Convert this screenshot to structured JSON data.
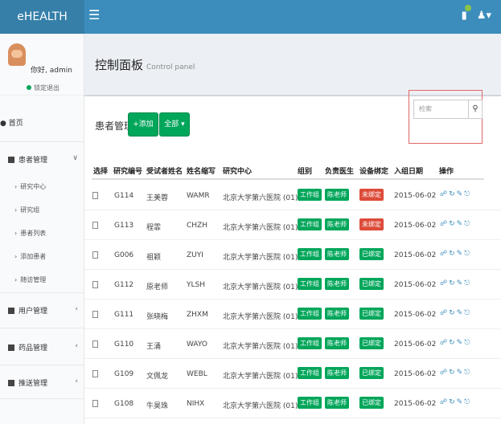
{
  "app": {
    "logo": "eHEALTH",
    "menu_icon": "hamburger-icon",
    "notif_icon": "battery-icon",
    "user_icon": "user-icon"
  },
  "user": {
    "greeting": "你好, admin",
    "status": "锁定退出"
  },
  "sidebar": {
    "home": "首页",
    "patient_mgmt": "患者管理",
    "sub": [
      "研究中心",
      "研究组",
      "患者列表",
      "添加患者",
      "随访管理"
    ],
    "user_mgmt": "用户管理",
    "drug_mgmt": "药品管理",
    "followup_mgmt": "推送管理"
  },
  "page": {
    "title": "控制面板",
    "subtitle": "Control panel"
  },
  "box": {
    "title": "患者管理",
    "add_label": "+添加",
    "all_label": "全部 ▾"
  },
  "search": {
    "placeholder": "检索"
  },
  "table": {
    "headers": [
      "选择",
      "研究编号",
      "受试者姓名",
      "姓名缩写",
      "研究中心",
      "组别",
      "负责医生",
      "设备绑定",
      "入组日期",
      "操作"
    ],
    "rows": [
      {
        "id": "G114",
        "name": "王美蓉",
        "abbr": "WAMR",
        "center": "北京大学第六医院 (01)",
        "group": "工作组",
        "doctor": "陈老师",
        "device": "未绑定",
        "date": "2015-06-02"
      },
      {
        "id": "G113",
        "name": "程霏",
        "abbr": "CHZH",
        "center": "北京大学第六医院 (01)",
        "group": "工作组",
        "doctor": "陈老师",
        "device": "未绑定",
        "date": "2015-06-02"
      },
      {
        "id": "G006",
        "name": "祖颖",
        "abbr": "ZUYI",
        "center": "北京大学第六医院 (01)",
        "group": "工作组",
        "doctor": "陈老师",
        "device": "已绑定",
        "date": "2015-06-02"
      },
      {
        "id": "G112",
        "name": "原老师",
        "abbr": "YLSH",
        "center": "北京大学第六医院 (01)",
        "group": "工作组",
        "doctor": "陈老师",
        "device": "已绑定",
        "date": "2015-06-02"
      },
      {
        "id": "G111",
        "name": "张晓梅",
        "abbr": "ZHXM",
        "center": "北京大学第六医院 (01)",
        "group": "工作组",
        "doctor": "陈老师",
        "device": "已绑定",
        "date": "2015-06-02"
      },
      {
        "id": "G110",
        "name": "王涌",
        "abbr": "WAYO",
        "center": "北京大学第六医院 (01)",
        "group": "工作组",
        "doctor": "陈老师",
        "device": "已绑定",
        "date": "2015-06-02"
      },
      {
        "id": "G109",
        "name": "文佩龙",
        "abbr": "WEBL",
        "center": "北京大学第六医院 (01)",
        "group": "工作组",
        "doctor": "陈老师",
        "device": "已绑定",
        "date": "2015-06-02"
      },
      {
        "id": "G108",
        "name": "牛昊珠",
        "abbr": "NIHX",
        "center": "北京大学第六医院 (01)",
        "group": "工作组",
        "doctor": "陈老师",
        "device": "已绑定",
        "date": "2015-06-02"
      }
    ],
    "ops": "⊖⟳☑🗑"
  },
  "colors": {
    "accent": "#3c8dbc",
    "green": "#00a65a",
    "red": "#dd4b39"
  }
}
